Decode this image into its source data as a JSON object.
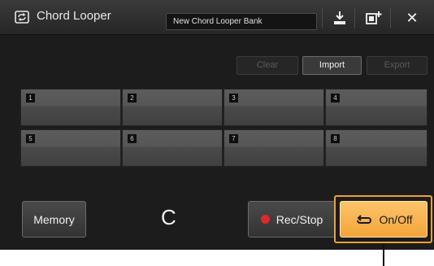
{
  "window": {
    "title": "Chord Looper",
    "bank_name": "New Chord Looper Bank",
    "icons": {
      "app": "chord-looper-icon",
      "save": "save-icon",
      "load": "load-bank-icon",
      "close": "close-icon"
    },
    "close_glyph": "✕"
  },
  "toolbar": {
    "clear_label": "Clear",
    "import_label": "Import",
    "export_label": "Export"
  },
  "grid": {
    "cells": [
      {
        "number": "1"
      },
      {
        "number": "2"
      },
      {
        "number": "3"
      },
      {
        "number": "4"
      },
      {
        "number": "5"
      },
      {
        "number": "6"
      },
      {
        "number": "7"
      },
      {
        "number": "8"
      }
    ]
  },
  "controls": {
    "memory_label": "Memory",
    "chord": "C",
    "rec_stop_label": "Rec/Stop",
    "on_off_label": "On/Off"
  },
  "colors": {
    "accent_orange": "#f4a43a",
    "rec_red": "#e0282a",
    "background": "#1c1c1c"
  }
}
